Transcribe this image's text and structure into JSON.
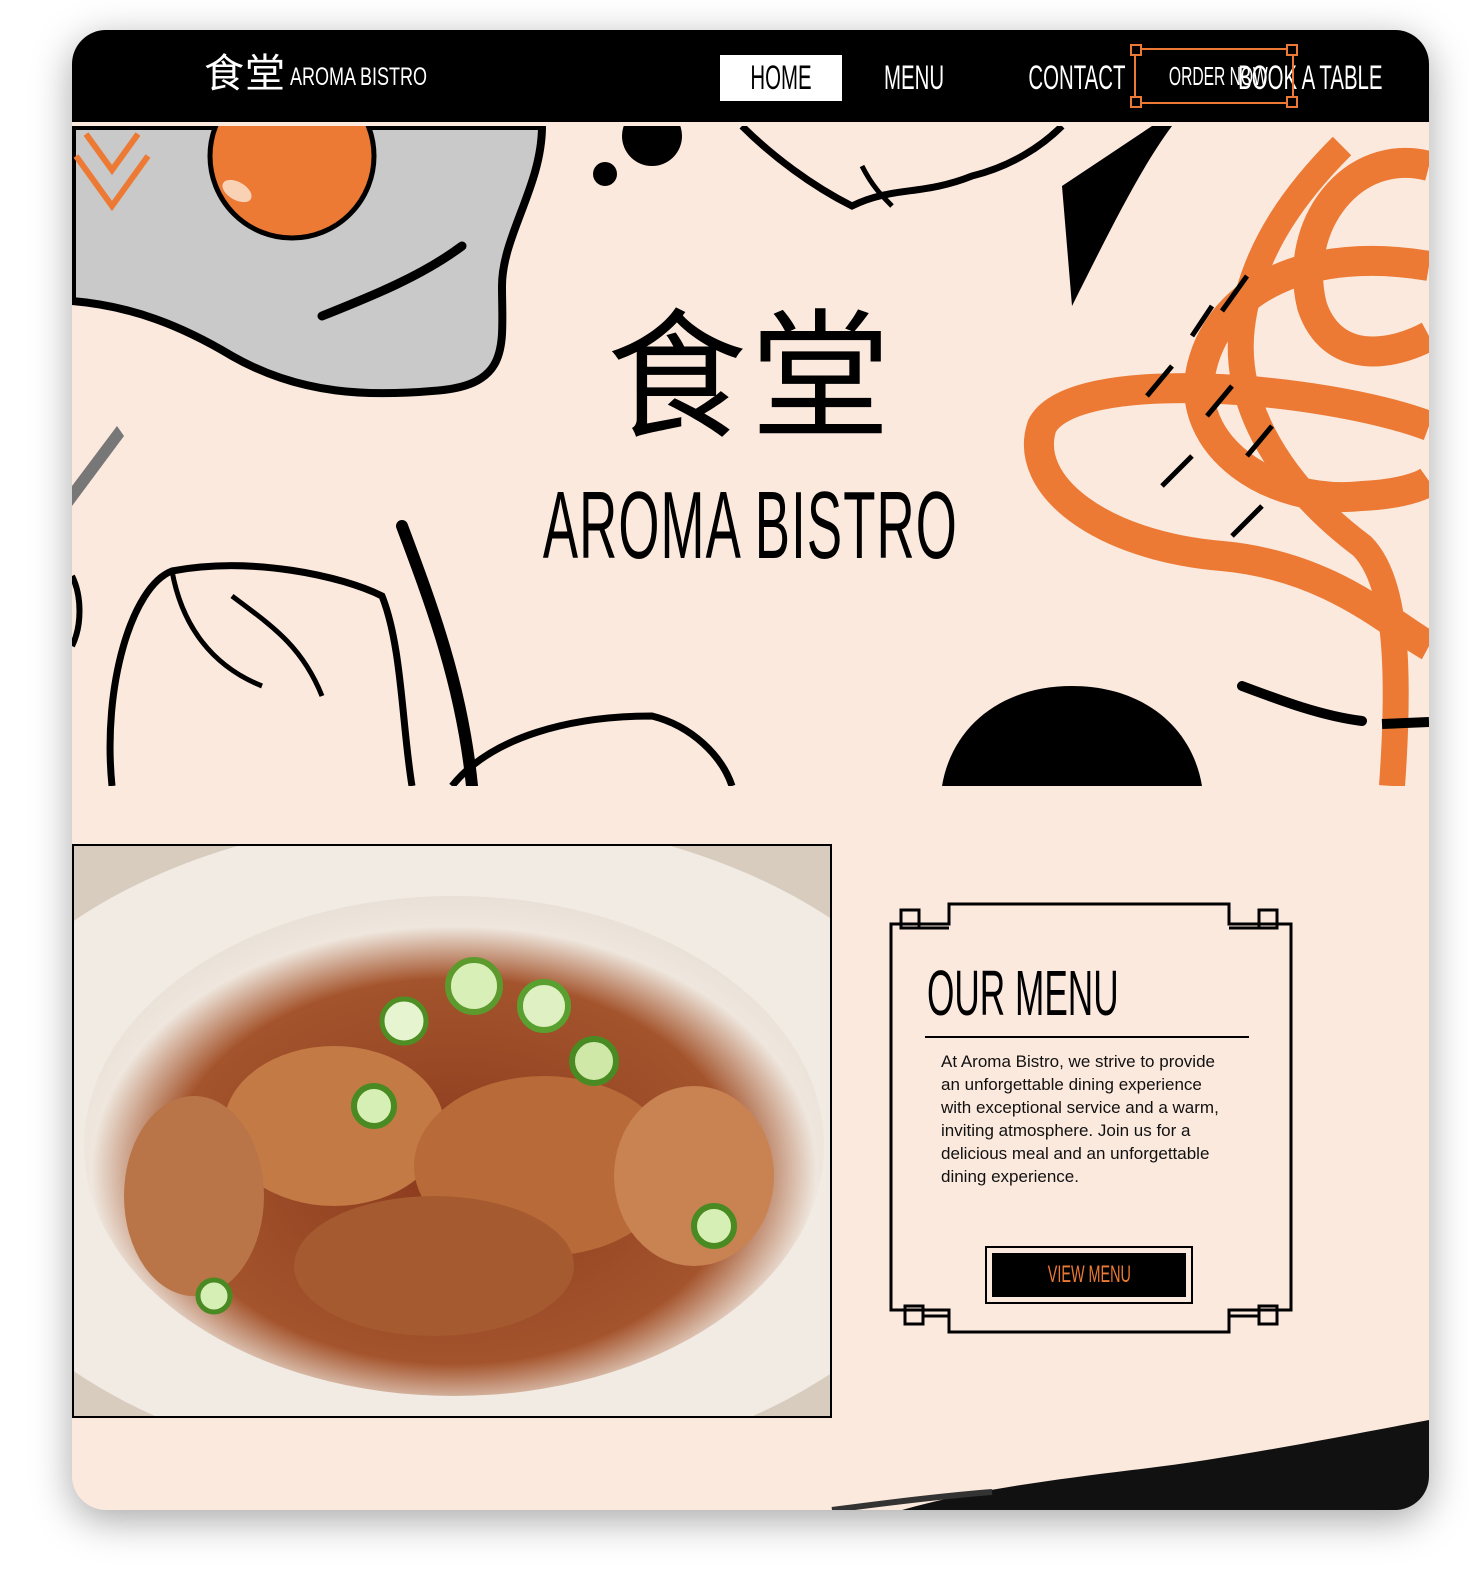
{
  "nav": {
    "logo_cjk": "食堂",
    "logo_text": "AROMA BISTRO",
    "links": [
      "HOME",
      "MENU",
      "CONTACT",
      "BOOK A TABLE"
    ],
    "active": "HOME",
    "order_label": "ORDER NOW"
  },
  "hero": {
    "title_cjk": "食堂",
    "title": "AROMA BISTRO"
  },
  "menu_section": {
    "heading": "OUR MENU",
    "description": "At Aroma Bistro, we strive to provide an unforgettable dining experience with exceptional service and a warm, inviting atmosphere. Join us for a delicious meal and an unforgettable dining experience.",
    "button_label": "VIEW MENU"
  },
  "colors": {
    "accent": "#ec7a34",
    "background": "#fbe9de",
    "nav_background": "#000000"
  },
  "icons": [
    "external-link-icon",
    "chevron-down-icon"
  ]
}
